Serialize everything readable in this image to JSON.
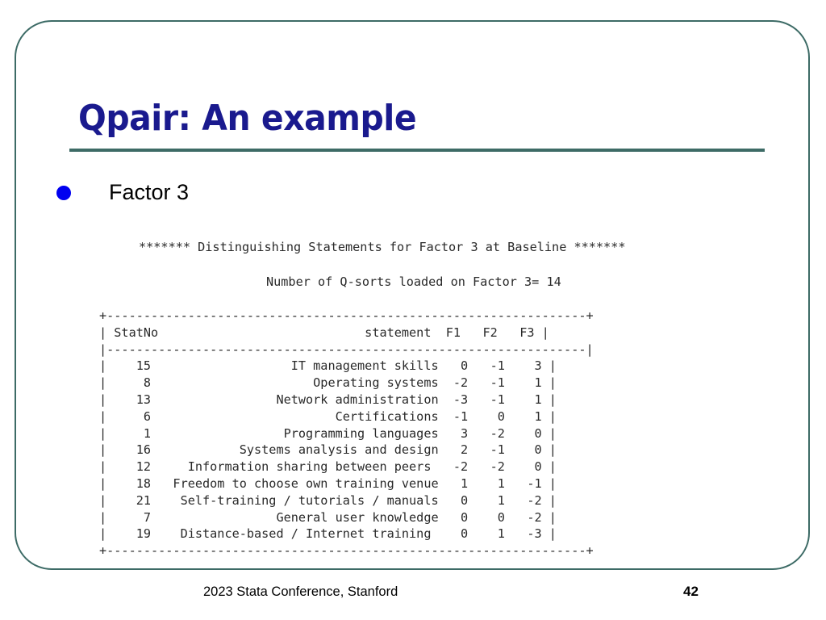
{
  "slide": {
    "title": "Qpair: An example",
    "bullet": {
      "marker": "bullet-dot",
      "label": "Factor 3"
    },
    "frame_color": "#3d6b66",
    "title_color": "#1a1a8e",
    "bullet_color": "#0000f0"
  },
  "output": {
    "header_line": "******* Distinguishing Statements for Factor 3 at Baseline *******",
    "subheader_line": "Number of Q-sorts loaded on Factor 3= 14",
    "table": {
      "top_border": "+-----------------------------------------------------------------+",
      "header_row": "| StatNo                              statement  F1   F2   F3 |",
      "header_separator": "|-----------------------------------------------------------------|",
      "bottom_border": "+-----------------------------------------------------------------+",
      "columns": [
        "StatNo",
        "statement",
        "F1",
        "F2",
        "F3"
      ],
      "rows": [
        {
          "statno": "15",
          "statement": "IT management skills",
          "f1": "0",
          "f2": "-1",
          "f3": "3"
        },
        {
          "statno": "8",
          "statement": "Operating systems",
          "f1": "-2",
          "f2": "-1",
          "f3": "1"
        },
        {
          "statno": "13",
          "statement": "Network administration",
          "f1": "-3",
          "f2": "-1",
          "f3": "1"
        },
        {
          "statno": "6",
          "statement": "Certifications",
          "f1": "-1",
          "f2": "0",
          "f3": "1"
        },
        {
          "statno": "1",
          "statement": "Programming languages",
          "f1": "3",
          "f2": "-2",
          "f3": "0"
        },
        {
          "statno": "16",
          "statement": "Systems analysis and design",
          "f1": "2",
          "f2": "-1",
          "f3": "0"
        },
        {
          "statno": "12",
          "statement": "Information sharing between peers",
          "f1": "-2",
          "f2": "-2",
          "f3": "0"
        },
        {
          "statno": "18",
          "statement": "Freedom to choose own training venue",
          "f1": "1",
          "f2": "1",
          "f3": "-1"
        },
        {
          "statno": "21",
          "statement": "Self-training / tutorials / manuals",
          "f1": "0",
          "f2": "1",
          "f3": "-2"
        },
        {
          "statno": "7",
          "statement": "General user knowledge",
          "f1": "0",
          "f2": "0",
          "f3": "-2"
        },
        {
          "statno": "19",
          "statement": "Distance-based / Internet training",
          "f1": "0",
          "f2": "1",
          "f3": "-3"
        }
      ],
      "rendered_text": "+-----------------------------------------------------------------+\n| StatNo                            statement  F1   F2   F3 |\n|-----------------------------------------------------------------|\n|    15                   IT management skills   0   -1    3 |\n|     8                      Operating systems  -2   -1    1 |\n|    13                 Network administration  -3   -1    1 |\n|     6                         Certifications  -1    0    1 |\n|     1                  Programming languages   3   -2    0 |\n|    16            Systems analysis and design   2   -1    0 |\n|    12     Information sharing between peers   -2   -2    0 |\n|    18   Freedom to choose own training venue   1    1   -1 |\n|    21    Self-training / tutorials / manuals   0    1   -2 |\n|     7                 General user knowledge   0    0   -2 |\n|    19    Distance-based / Internet training    0    1   -3 |\n+-----------------------------------------------------------------+"
    }
  },
  "footer": {
    "conference": "2023 Stata Conference, Stanford",
    "page_number": "42"
  }
}
